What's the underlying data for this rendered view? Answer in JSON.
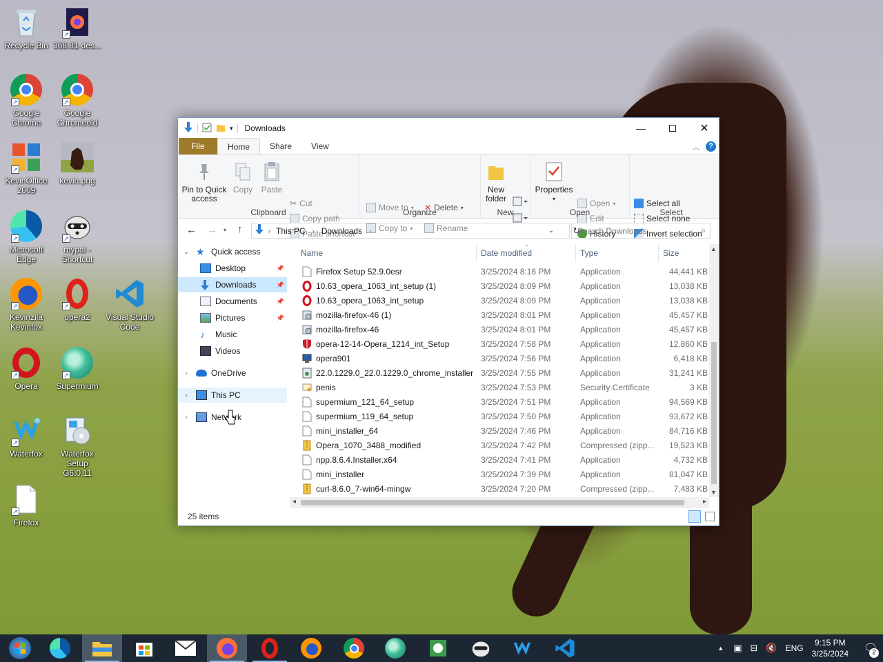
{
  "desktop": {
    "icons": [
      {
        "label": "Recycle Bin"
      },
      {
        "label": "368.81-des..."
      },
      {
        "label": "Google Chrome"
      },
      {
        "label": "Google Chromeold"
      },
      {
        "label": "KevinOffice 2009"
      },
      {
        "label": "kevin.png"
      },
      {
        "label": "Microsoft Edge"
      },
      {
        "label": "mypal - Shortcut"
      },
      {
        "label": "Kevinzila Kevinfox"
      },
      {
        "label": "opera2"
      },
      {
        "label": "Visual Studio Code"
      },
      {
        "label": "Opera"
      },
      {
        "label": "Supermium"
      },
      {
        "label": "Waterfox"
      },
      {
        "label": "Waterfox Setup G6.0.11"
      },
      {
        "label": "Firefox"
      }
    ]
  },
  "window": {
    "title": "Downloads",
    "tabs": {
      "file": "File",
      "home": "Home",
      "share": "Share",
      "view": "View"
    },
    "ribbon": {
      "clipboard": {
        "pin": "Pin to Quick access",
        "copy": "Copy",
        "paste": "Paste",
        "cut": "Cut",
        "copy_path": "Copy path",
        "paste_shortcut": "Paste shortcut",
        "group": "Clipboard"
      },
      "organize": {
        "move_to": "Move to",
        "copy_to": "Copy to",
        "delete": "Delete",
        "rename": "Rename",
        "group": "Organize"
      },
      "new": {
        "new_folder": "New folder",
        "group": "New"
      },
      "open": {
        "properties": "Properties",
        "open": "Open",
        "edit": "Edit",
        "history": "History",
        "group": "Open"
      },
      "select": {
        "select_all": "Select all",
        "select_none": "Select none",
        "invert": "Invert selection",
        "group": "Select"
      }
    },
    "address": {
      "part1": "This PC",
      "part2": "Downloads"
    },
    "search": {
      "placeholder": "Search Downloads"
    },
    "nav": {
      "quick_access": "Quick access",
      "desktop": "Desktop",
      "downloads": "Downloads",
      "documents": "Documents",
      "pictures": "Pictures",
      "music": "Music",
      "videos": "Videos",
      "onedrive": "OneDrive",
      "this_pc": "This PC",
      "network": "Network"
    },
    "columns": {
      "name": "Name",
      "date": "Date modified",
      "type": "Type",
      "size": "Size"
    },
    "files": [
      {
        "name": "Firefox Setup 52.9.0esr",
        "date": "3/25/2024 8:16 PM",
        "type": "Application",
        "size": "44,441 KB",
        "icon": "blank"
      },
      {
        "name": "10.63_opera_1063_int_setup (1)",
        "date": "3/25/2024 8:09 PM",
        "type": "Application",
        "size": "13,038 KB",
        "icon": "opera"
      },
      {
        "name": "10.63_opera_1063_int_setup",
        "date": "3/25/2024 8:09 PM",
        "type": "Application",
        "size": "13,038 KB",
        "icon": "opera"
      },
      {
        "name": "mozilla-firefox-46 (1)",
        "date": "3/25/2024 8:01 PM",
        "type": "Application",
        "size": "45,457 KB",
        "icon": "installer"
      },
      {
        "name": "mozilla-firefox-46",
        "date": "3/25/2024 8:01 PM",
        "type": "Application",
        "size": "45,457 KB",
        "icon": "installer"
      },
      {
        "name": "opera-12-14-Opera_1214_int_Setup",
        "date": "3/25/2024 7:58 PM",
        "type": "Application",
        "size": "12,860 KB",
        "icon": "shield"
      },
      {
        "name": "opera901",
        "date": "3/25/2024 7:56 PM",
        "type": "Application",
        "size": "6,418 KB",
        "icon": "monitor"
      },
      {
        "name": "22.0.1229.0_22.0.1229.0_chrome_installer",
        "date": "3/25/2024 7:55 PM",
        "type": "Application",
        "size": "31,241 KB",
        "icon": "setup"
      },
      {
        "name": "penis",
        "date": "3/25/2024 7:53 PM",
        "type": "Security Certificate",
        "size": "3 KB",
        "icon": "cert"
      },
      {
        "name": "supermium_121_64_setup",
        "date": "3/25/2024 7:51 PM",
        "type": "Application",
        "size": "94,569 KB",
        "icon": "blank"
      },
      {
        "name": "supermium_119_64_setup",
        "date": "3/25/2024 7:50 PM",
        "type": "Application",
        "size": "93,672 KB",
        "icon": "blank"
      },
      {
        "name": "mini_installer_64",
        "date": "3/25/2024 7:46 PM",
        "type": "Application",
        "size": "84,716 KB",
        "icon": "blank"
      },
      {
        "name": "Opera_1070_3488_modified",
        "date": "3/25/2024 7:42 PM",
        "type": "Compressed (zipp...",
        "size": "19,523 KB",
        "icon": "zip"
      },
      {
        "name": "npp.8.6.4.Installer.x64",
        "date": "3/25/2024 7:41 PM",
        "type": "Application",
        "size": "4,732 KB",
        "icon": "blank"
      },
      {
        "name": "mini_installer",
        "date": "3/25/2024 7:39 PM",
        "type": "Application",
        "size": "81,047 KB",
        "icon": "blank"
      },
      {
        "name": "curl-8.6.0_7-win64-mingw",
        "date": "3/25/2024 7:20 PM",
        "type": "Compressed (zipp...",
        "size": "7,483 KB",
        "icon": "zip"
      }
    ],
    "status": "25 items"
  },
  "taskbar": {
    "lang": "ENG",
    "time": "9:15 PM",
    "date": "3/25/2024",
    "notif_count": "2"
  },
  "colors": {
    "accent": "#0078d7",
    "file_tab": "#9e7b2b",
    "selection": "#cce8ff",
    "taskbar": "#1c2733"
  }
}
